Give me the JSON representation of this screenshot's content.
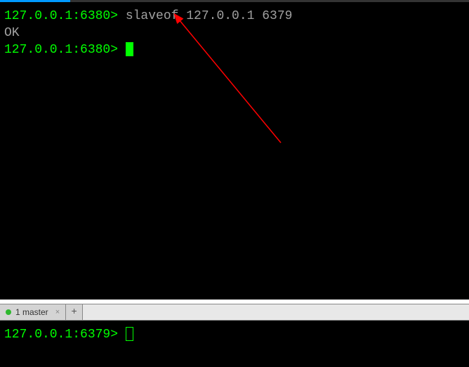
{
  "upper": {
    "lines": [
      {
        "prompt": "127.0.0.1:6380> ",
        "command": "slaveof 127.0.0.1 6379"
      },
      {
        "output": "OK"
      },
      {
        "prompt": "127.0.0.1:6380> ",
        "cursor": "filled"
      }
    ]
  },
  "tabs": {
    "items": [
      {
        "label": "1 master",
        "status": "connected"
      }
    ],
    "add_label": "+"
  },
  "lower": {
    "lines": [
      {
        "prompt": "127.0.0.1:6379> ",
        "cursor": "outline"
      }
    ]
  },
  "annotation": {
    "arrow_color": "#ff0000"
  }
}
